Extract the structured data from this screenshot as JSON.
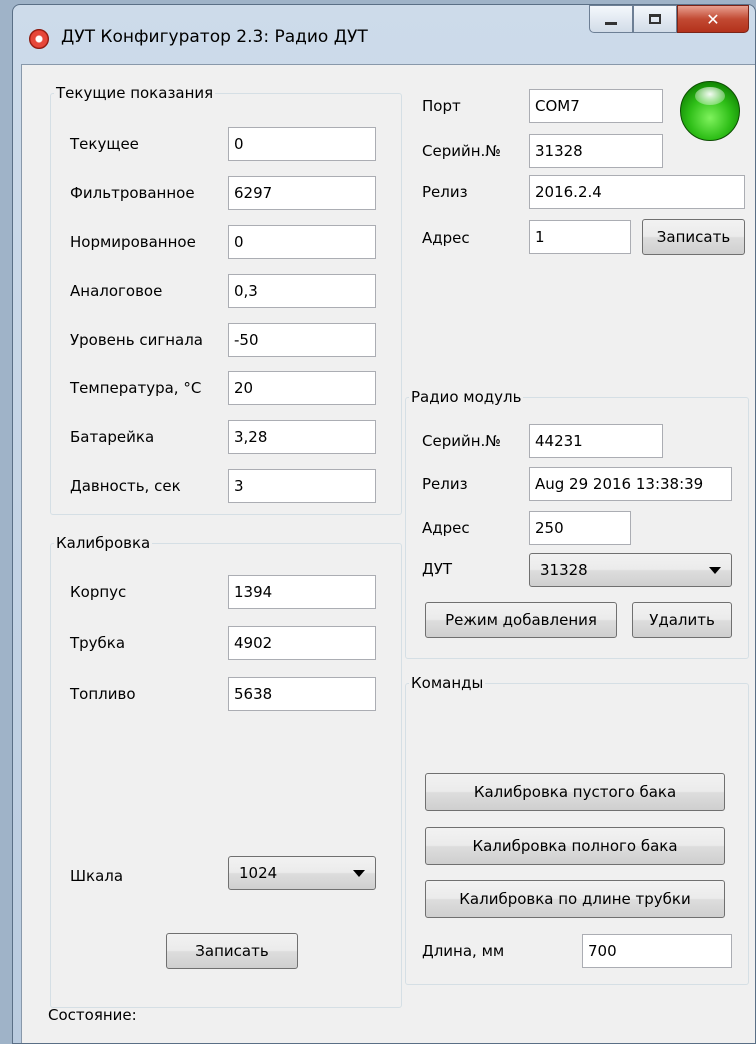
{
  "window": {
    "title": "ДУТ Конфигуратор 2.3: Радио ДУТ",
    "app_icon": "app-logo-icon"
  },
  "current": {
    "title": "Текущие показания",
    "rows": [
      {
        "label": "Текущее",
        "value": "0"
      },
      {
        "label": "Фильтрованное",
        "value": "6297"
      },
      {
        "label": "Нормированное",
        "value": "0"
      },
      {
        "label": "Аналоговое",
        "value": "0,3"
      },
      {
        "label": "Уровень сигнала",
        "value": "-50"
      },
      {
        "label": "Температура, °С",
        "value": "20"
      },
      {
        "label": "Батарейка",
        "value": "3,28"
      },
      {
        "label": "Давность, сек",
        "value": "3"
      }
    ]
  },
  "device": {
    "port_label": "Порт",
    "port_value": "COM7",
    "serial_label": "Серийн.№",
    "serial_value": "31328",
    "release_label": "Релиз",
    "release_value": "2016.2.4",
    "address_label": "Адрес",
    "address_value": "1",
    "write_button": "Записать",
    "status_led_color": "#2fbf18"
  },
  "calibration": {
    "title": "Калибровка",
    "rows": [
      {
        "label": "Корпус",
        "value": "1394"
      },
      {
        "label": "Трубка",
        "value": "4902"
      },
      {
        "label": "Топливо",
        "value": "5638"
      }
    ],
    "scale_label": "Шкала",
    "scale_value": "1024",
    "write_button": "Записать"
  },
  "radio": {
    "title": "Радио модуль",
    "serial_label": "Серийн.№",
    "serial_value": "44231",
    "release_label": "Релиз",
    "release_value": "Aug 29 2016 13:38:39",
    "address_label": "Адрес",
    "address_value": "250",
    "dut_label": "ДУТ",
    "dut_value": "31328",
    "add_mode_button": "Режим добавления",
    "delete_button": "Удалить"
  },
  "commands": {
    "title": "Команды",
    "empty_tank_button": "Калибровка пустого бака",
    "full_tank_button": "Калибровка полного бака",
    "tube_length_button": "Калибровка по длине трубки",
    "length_label": "Длина, мм",
    "length_value": "700"
  },
  "status": {
    "label": "Состояние:"
  }
}
